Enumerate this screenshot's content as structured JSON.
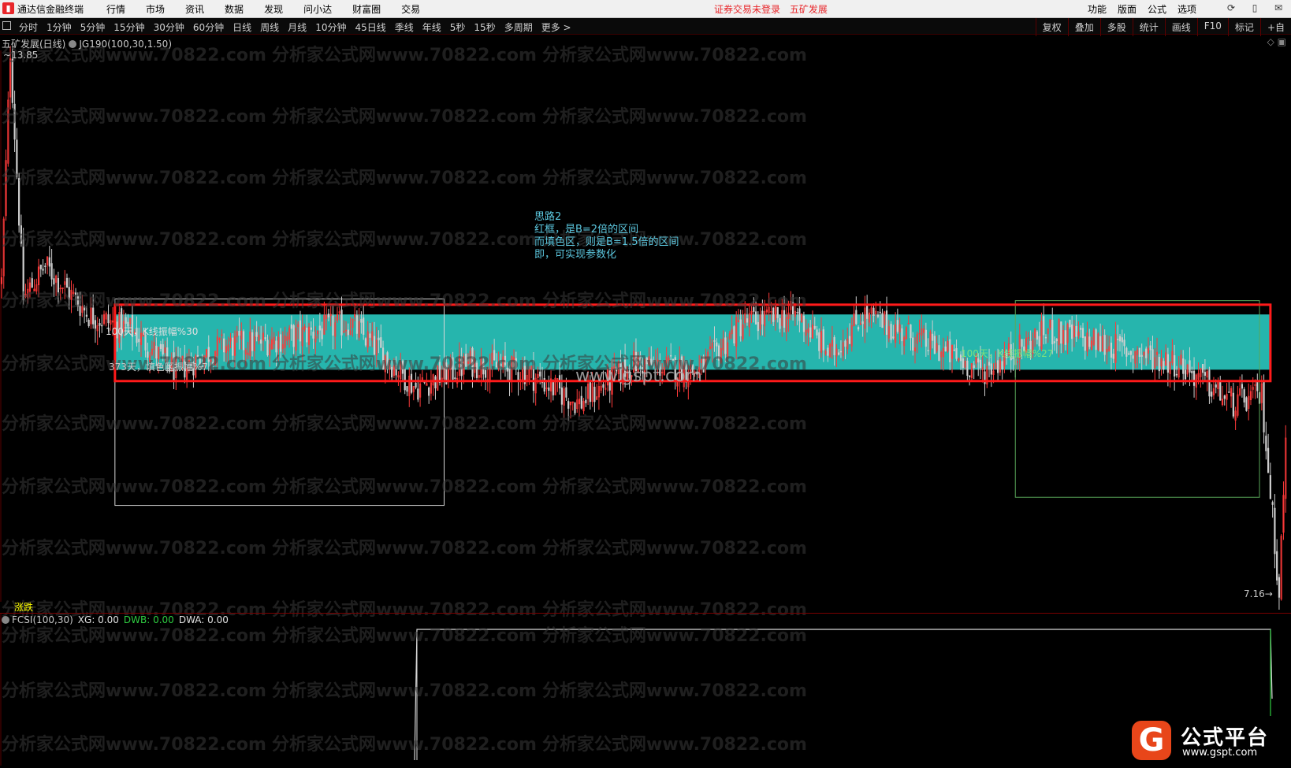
{
  "menubar": {
    "app_title": "通达信金融终端",
    "menus": [
      "行情",
      "市场",
      "资讯",
      "数据",
      "发现",
      "问小达",
      "财富圈",
      "交易"
    ],
    "status_text": "证券交易未登录",
    "stock_name": "五矿发展",
    "right_menus": [
      "功能",
      "版面",
      "公式",
      "选项"
    ]
  },
  "periodbar": {
    "periods": [
      "分时",
      "1分钟",
      "5分钟",
      "15分钟",
      "30分钟",
      "60分钟",
      "日线",
      "周线",
      "月线",
      "10分钟",
      "45日线",
      "季线",
      "年线",
      "5秒",
      "15秒",
      "多周期",
      "更多 >"
    ],
    "tools": [
      "复权",
      "叠加",
      "多股",
      "统计",
      "画线",
      "F10",
      "标记",
      "+自"
    ]
  },
  "main_chart": {
    "title": "五矿发展(日线)",
    "indicator": "JG190(100,30,1.50)",
    "price_high": "13.85",
    "price_low": "7.16",
    "note_lines": [
      "思路2",
      "红框，是B=2倍的区间",
      "而填色区，则是B=1.5倍的区间",
      "即，可实现参数化"
    ],
    "box1_label": "100天，K线振幅%30",
    "box1_sub": "373天，填色区振幅%7",
    "box2_label": "100天，K线振幅%27",
    "watermark_center": "www.gspt.com",
    "watermark_repeat": "分析家公式网www.70822.com",
    "colors": {
      "fill_band": "#26b5ad",
      "red_frame": "#ff1a1a",
      "box1": "#d8d8d8",
      "box2": "#5aa85a",
      "candle_up": "#ff3a3a",
      "candle_down": "#cfcfcf"
    },
    "chart_data": {
      "type": "candlestick",
      "ylim": [
        7.16,
        13.85
      ],
      "trend_path": [
        [
          0,
          11.0
        ],
        [
          4,
          13.85
        ],
        [
          10,
          10.8
        ],
        [
          20,
          11.2
        ],
        [
          40,
          10.6
        ],
        [
          60,
          10.4
        ],
        [
          80,
          9.9
        ],
        [
          100,
          10.2
        ],
        [
          130,
          10.3
        ],
        [
          160,
          10.5
        ],
        [
          190,
          9.7
        ],
        [
          215,
          10.0
        ],
        [
          240,
          9.9
        ],
        [
          265,
          9.5
        ],
        [
          290,
          10.0
        ],
        [
          320,
          9.9
        ],
        [
          340,
          10.5
        ],
        [
          365,
          10.6
        ],
        [
          380,
          10.1
        ],
        [
          395,
          10.6
        ],
        [
          420,
          10.3
        ],
        [
          450,
          9.9
        ],
        [
          480,
          10.4
        ],
        [
          510,
          10.2
        ],
        [
          540,
          10.0
        ],
        [
          565,
          9.5
        ],
        [
          578,
          9.6
        ],
        [
          586,
          7.2
        ],
        [
          590,
          9.6
        ]
      ],
      "fill_band_range": [
        9.92,
        10.6
      ],
      "red_frame_range": [
        9.78,
        10.72
      ],
      "box1_range": [
        8.25,
        10.79
      ],
      "box2_range": [
        8.35,
        10.77
      ]
    }
  },
  "sub_tab": "涨跌",
  "sub_chart": {
    "name": "FCSI(100,30)",
    "xg": "XG: 0.00",
    "dwb": "DWB: 0.00",
    "dwa": "DWA: 0.00",
    "colors": {
      "dwb": "#2ecc40",
      "frame": "#d8d8d8"
    }
  },
  "brand": {
    "glyph": "G",
    "name": "公式平台",
    "url": "www.gspt.com"
  }
}
